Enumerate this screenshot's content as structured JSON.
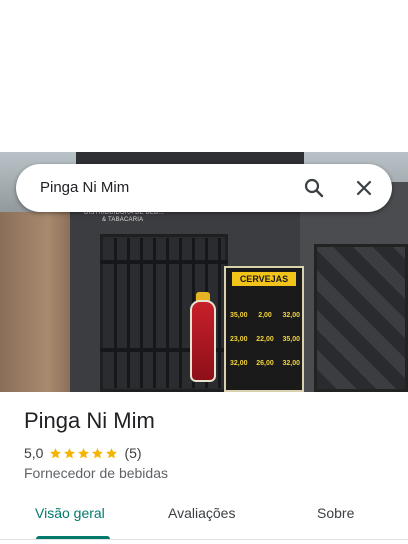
{
  "search": {
    "query": "Pinga Ni Mim"
  },
  "photo": {
    "sign_line1": "DISTRIBUIDORA DE BEB...",
    "sign_line2": "& TABACARIA",
    "poster_title": "CERVEJAS",
    "poster_prices": [
      [
        "35,00",
        "2,00",
        "32,00"
      ],
      [
        "23,00",
        "22,00",
        "35,00"
      ],
      [
        "32,00",
        "26,00",
        "32,00"
      ]
    ]
  },
  "place": {
    "name": "Pinga Ni Mim",
    "rating": "5,0",
    "stars": 5,
    "review_count": "(5)",
    "category": "Fornecedor de bebidas"
  },
  "tabs": [
    {
      "label": "Visão geral",
      "active": true
    },
    {
      "label": "Avaliações",
      "active": false
    },
    {
      "label": "Sobre",
      "active": false
    }
  ],
  "colors": {
    "accent": "#00796b",
    "star": "#f4b400"
  }
}
